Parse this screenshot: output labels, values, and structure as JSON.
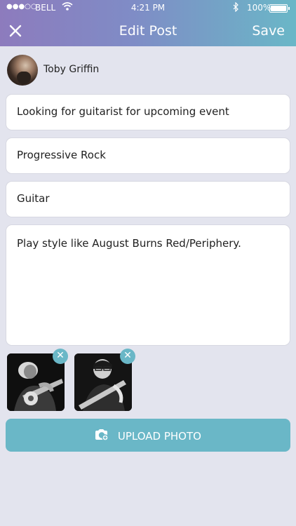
{
  "status_bar": {
    "signal": "●●●○○",
    "carrier": "BELL",
    "time": "4:21 PM",
    "battery_percent": "100%"
  },
  "header": {
    "title": "Edit Post",
    "save_label": "Save",
    "close_icon": "close-icon"
  },
  "author": {
    "name": "Toby Griffin"
  },
  "fields": {
    "title": "Looking for guitarist for upcoming event",
    "genre": "Progressive Rock",
    "instrument": "Guitar",
    "description": "Play style like August Burns Red/Periphery."
  },
  "photos": [
    {
      "alt": "guitarist-photo-1",
      "remove_icon": "close-icon"
    },
    {
      "alt": "guitarist-photo-2",
      "remove_icon": "close-icon"
    }
  ],
  "upload": {
    "label": "UPLOAD PHOTO",
    "icon": "camera-add-icon"
  },
  "colors": {
    "accent": "#6ab7c7",
    "header_start": "#8d7bbd",
    "background": "#e3e4ee"
  }
}
